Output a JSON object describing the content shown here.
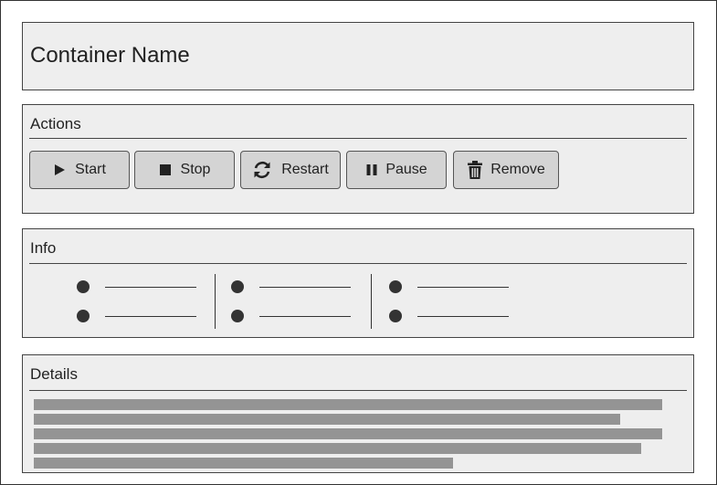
{
  "header": {
    "title": "Container Name"
  },
  "actions": {
    "title": "Actions",
    "buttons": [
      {
        "id": "start",
        "label": "Start",
        "icon": "play-icon"
      },
      {
        "id": "stop",
        "label": "Stop",
        "icon": "stop-icon"
      },
      {
        "id": "restart",
        "label": "Restart",
        "icon": "refresh-icon"
      },
      {
        "id": "pause",
        "label": "Pause",
        "icon": "pause-icon"
      },
      {
        "id": "remove",
        "label": "Remove",
        "icon": "trash-icon"
      }
    ]
  },
  "info": {
    "title": "Info"
  },
  "details": {
    "title": "Details"
  },
  "colors": {
    "panel_bg": "#eeeeee",
    "button_bg": "#d4d4d4",
    "placeholder_bar": "#949494",
    "text": "#222222"
  }
}
